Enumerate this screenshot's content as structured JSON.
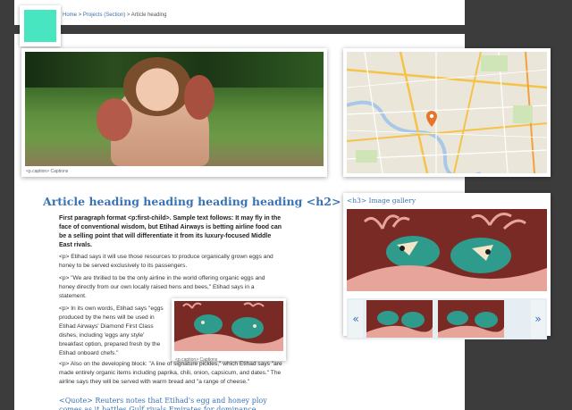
{
  "breadcrumb": {
    "home": "Home",
    "sep1": " > ",
    "section": "Projects (Section)",
    "sep2": " > ",
    "current": "Article heading"
  },
  "hero": {
    "caption": "<p.caption> Captions"
  },
  "article": {
    "heading": "Article heading heading heading heading <h2>",
    "lead": "First paragraph format <p:first-child>. Sample text follows:  It may fly in the face of conventional wisdom, but Etihad Airways is betting airline food can be a selling point that will differentiate it from its luxury-focused Middle East rivals.",
    "p1": "<p> Etihad says it will use those resources to produce organically grown eggs and honey to be served exclusively to its passengers.",
    "p2": "<p> \"We are thrilled to be the only airline in the world offering organic eggs and honey directly from our own locally raised hens and bees,\" Etihad says in a statement.",
    "p3": "<p> In its own words, Etihad says \"eggs produced by the hens will be used in Etihad Airways' Diamond First Class dishes, including 'eggs any style' breakfast option, prepared fresh by the Etihad onboard chefs.\"",
    "p4": "<p> Also on the developing block: \"A line of signature pickles,\" which Etihad says \"are made entirely organic items including paprika, chili, onion, capsicum, and dates.\" The airline says they will be served with warm bread and \"a range of cheese.\"",
    "quote": "<Quote> Reuters notes that Etihad's egg and honey ploy comes as it battles Gulf rivals Emirates for dominance"
  },
  "inline_figure": {
    "caption": "<p.caption> Captions"
  },
  "gallery": {
    "title": "<h3> Image gallery",
    "prev": "«",
    "next": "»"
  },
  "colors": {
    "accent": "#3a73b5",
    "logo": "#47e6c1",
    "illustration_bg": "#7a2a25",
    "illustration_teal": "#2e9b8c",
    "illustration_pink": "#e6a49a"
  },
  "icons": [
    "map-pin-icon",
    "arrow-left-icon",
    "arrow-right-icon"
  ]
}
